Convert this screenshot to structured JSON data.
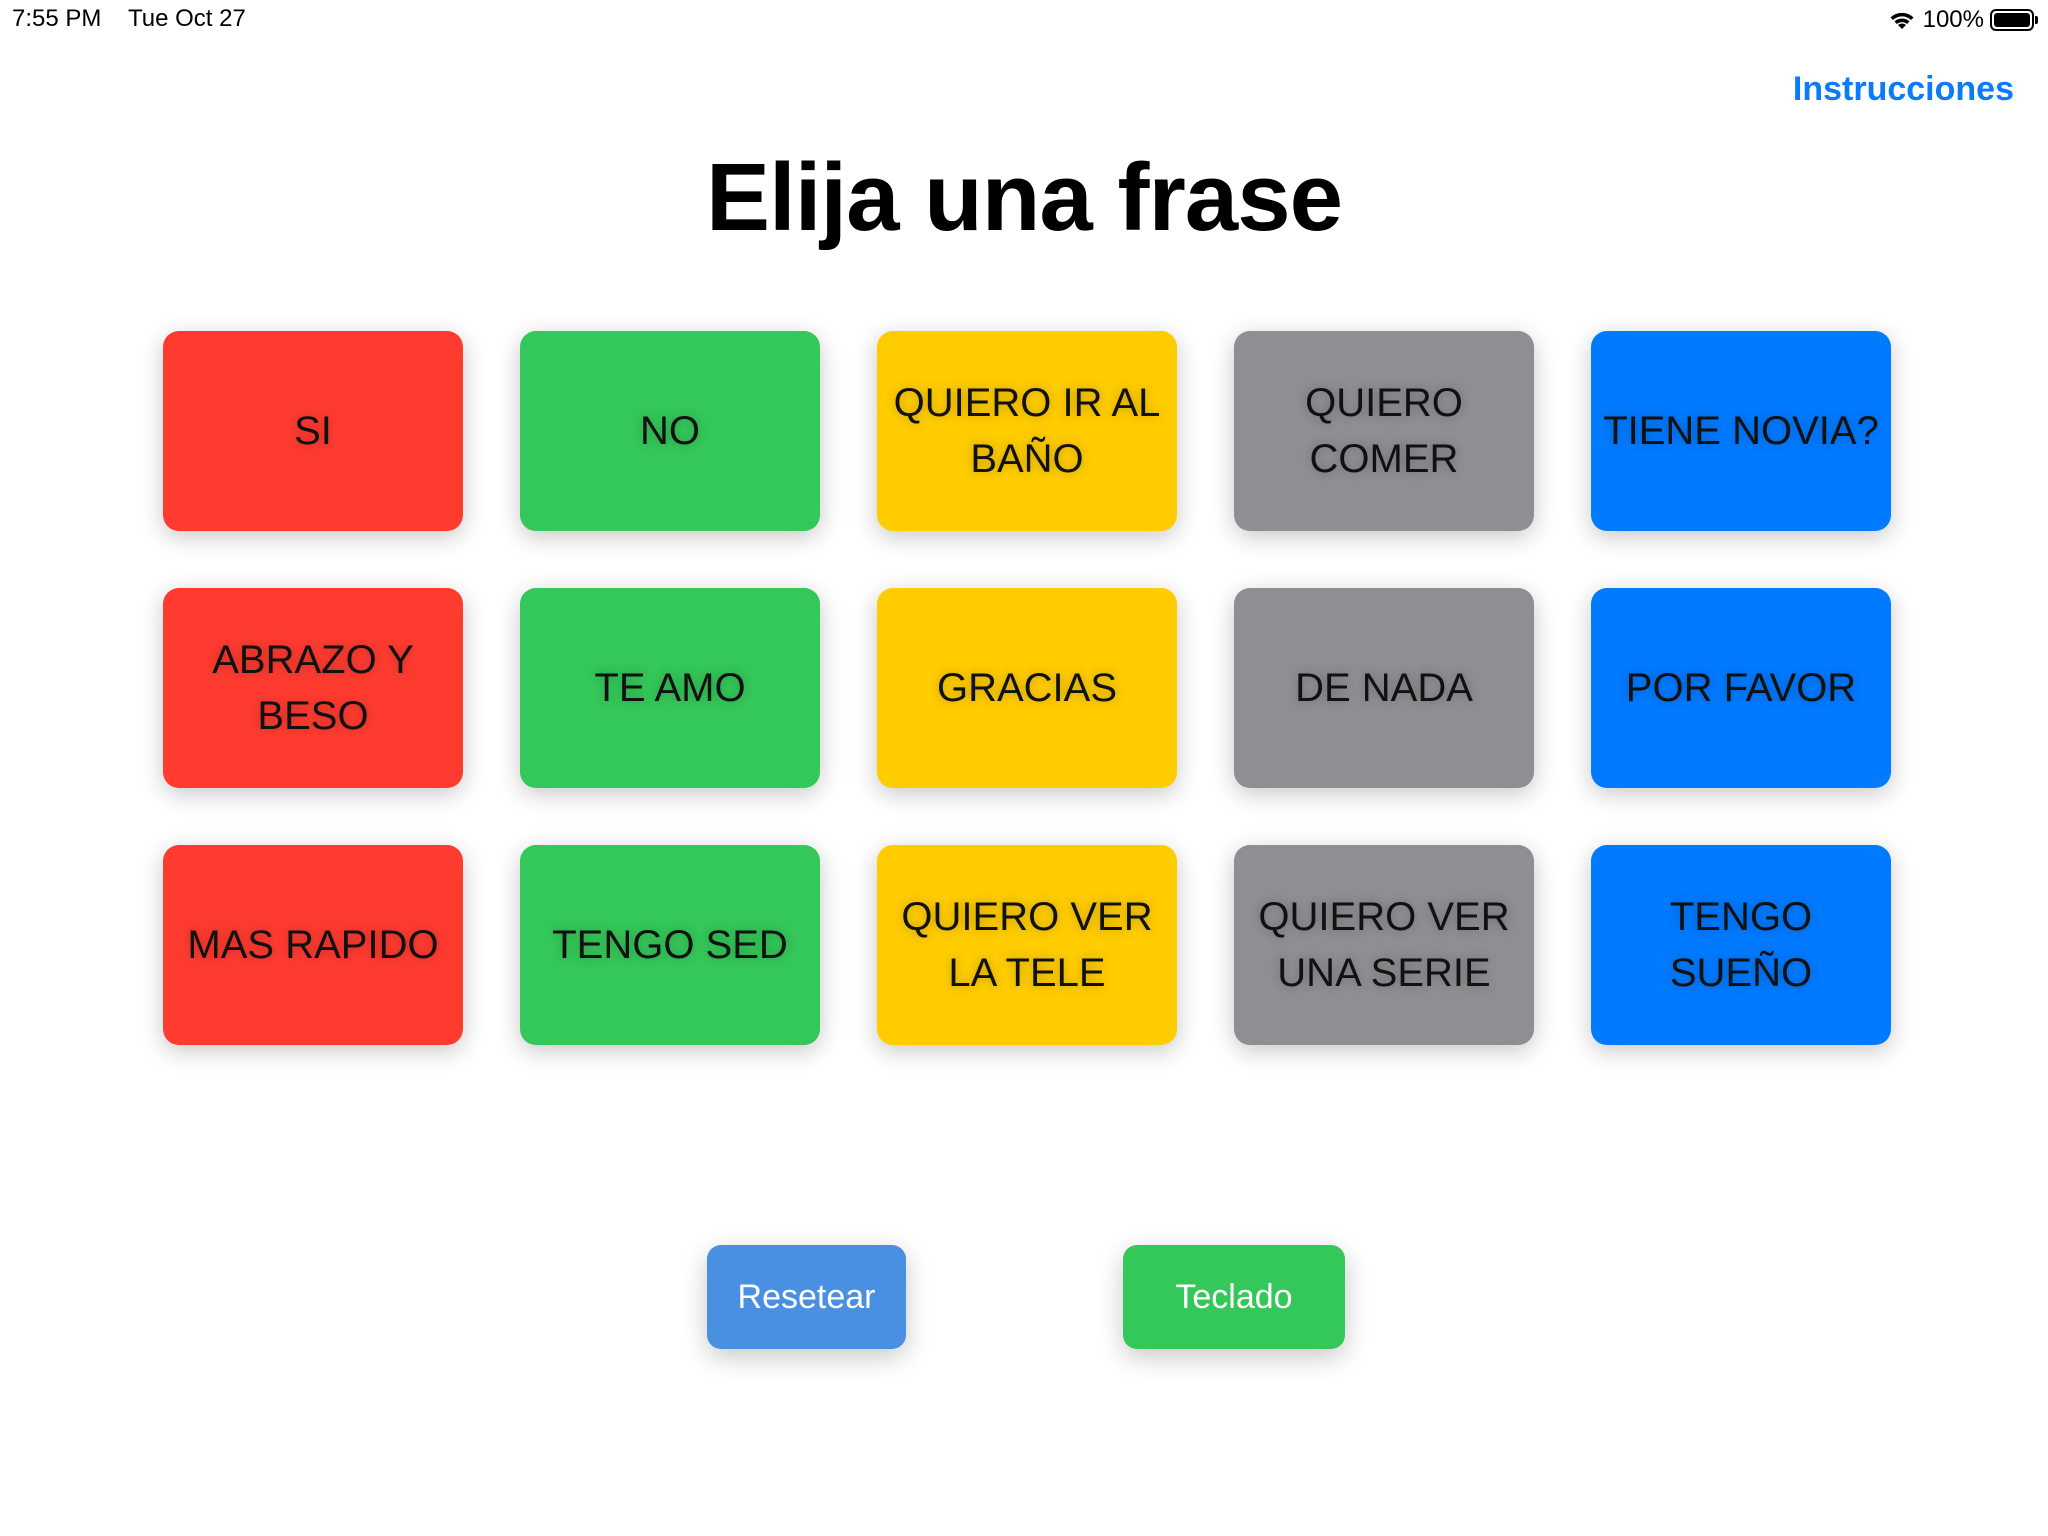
{
  "status_bar": {
    "time": "7:55 PM",
    "date": "Tue Oct 27",
    "battery_percent": "100%",
    "battery_level": 1.0,
    "wifi_icon": "wifi-icon",
    "battery_icon": "battery-icon"
  },
  "nav": {
    "instructions_label": "Instrucciones",
    "color": "#0a7aff"
  },
  "title": "Elija una frase",
  "colors": {
    "red": "#ff3b30",
    "green": "#34c759",
    "yellow": "#ffcc00",
    "gray": "#8e8e93",
    "blue": "#007aff",
    "reset": "#4a90e2",
    "keyboard": "#34c759"
  },
  "phrases": [
    {
      "label": "SI",
      "color": "#ff3b30"
    },
    {
      "label": "NO",
      "color": "#34c759"
    },
    {
      "label": "QUIERO IR AL BAÑO",
      "color": "#ffcc00"
    },
    {
      "label": "QUIERO COMER",
      "color": "#8e8e93"
    },
    {
      "label": "TIENE NOVIA?",
      "color": "#007aff"
    },
    {
      "label": "ABRAZO Y BESO",
      "color": "#ff3b30"
    },
    {
      "label": "TE AMO",
      "color": "#34c759"
    },
    {
      "label": "GRACIAS",
      "color": "#ffcc00"
    },
    {
      "label": "DE NADA",
      "color": "#8e8e93"
    },
    {
      "label": "POR FAVOR",
      "color": "#007aff"
    },
    {
      "label": "MAS RAPIDO",
      "color": "#ff3b30"
    },
    {
      "label": "TENGO SED",
      "color": "#34c759"
    },
    {
      "label": "QUIERO VER LA TELE",
      "color": "#ffcc00"
    },
    {
      "label": "QUIERO VER UNA SERIE",
      "color": "#8e8e93"
    },
    {
      "label": "TENGO SUEÑO",
      "color": "#007aff"
    }
  ],
  "actions": {
    "reset_label": "Resetear",
    "keyboard_label": "Teclado"
  }
}
